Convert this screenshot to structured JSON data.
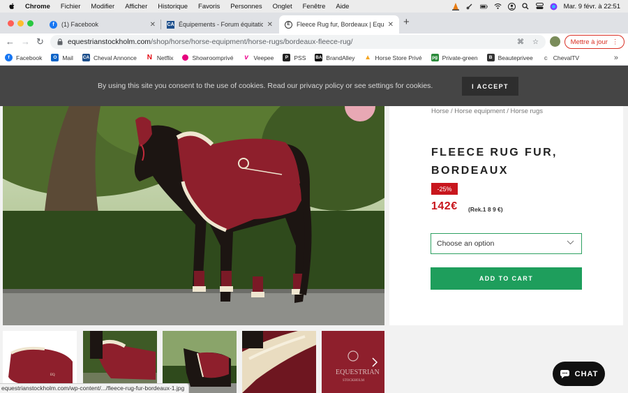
{
  "menubar": {
    "app": "Chrome",
    "items": [
      "Fichier",
      "Modifier",
      "Afficher",
      "Historique",
      "Favoris",
      "Personnes",
      "Onglet",
      "Fenêtre",
      "Aide"
    ],
    "clock": "Mar. 9 févr. à  22:51"
  },
  "tabs": [
    {
      "title": "(1) Facebook",
      "icon": "facebook-icon"
    },
    {
      "title": "Équipements - Forum équitatio",
      "icon": "cheval-annonce-icon"
    },
    {
      "title": "Fleece Rug fur, Bordeaux | Equ",
      "icon": "equestrian-icon",
      "active": true
    }
  ],
  "toolbar": {
    "url_domain": "equestrianstockholm.com",
    "url_path": "/shop/horse/horse-equipment/horse-rugs/bordeaux-fleece-rug/",
    "update_label": "Mettre à jour"
  },
  "bookmarks": [
    {
      "label": "Facebook",
      "icon": "facebook-icon",
      "color": "#1877f2",
      "glyph": "f"
    },
    {
      "label": "Mail",
      "icon": "outlook-icon",
      "color": "#0a64c8",
      "glyph": "O"
    },
    {
      "label": "Cheval Annonce",
      "icon": "cheval-annonce-icon",
      "color": "#1d4f8c",
      "glyph": "CA"
    },
    {
      "label": "Netflix",
      "icon": "netflix-icon",
      "color": "#e50914",
      "glyph": "N"
    },
    {
      "label": "Showroomprivé",
      "icon": "showroomprive-icon",
      "color": "#e6007e",
      "glyph": "●"
    },
    {
      "label": "Veepee",
      "icon": "veepee-icon",
      "color": "#ec008c",
      "glyph": "v"
    },
    {
      "label": "PSS",
      "icon": "pss-icon",
      "color": "#222222",
      "glyph": "P"
    },
    {
      "label": "BrandAlley",
      "icon": "brandalley-icon",
      "color": "#111111",
      "glyph": "BA"
    },
    {
      "label": "Horse Store Privé",
      "icon": "horse-store-icon",
      "color": "#f5a623",
      "glyph": "▲"
    },
    {
      "label": "Private-green",
      "icon": "private-green-icon",
      "color": "#2a8a3a",
      "glyph": "pg"
    },
    {
      "label": "Beauteprivee",
      "icon": "beauteprivee-icon",
      "color": "#333333",
      "glyph": "B"
    },
    {
      "label": "ChevalTV",
      "icon": "chevaltv-icon",
      "color": "#888888",
      "glyph": "c"
    }
  ],
  "cookie": {
    "text": "By using this site you consent to the use of cookies. Read our privacy policy or see settings for cookies.",
    "accept_label": "I ACCEPT"
  },
  "product": {
    "breadcrumb": "Horse / Horse equipment / Horse rugs",
    "title": "FLEECE RUG FUR, BORDEAUX",
    "discount": "-25%",
    "price": "142€",
    "regular_price": "(Rek.1 8 9 €)",
    "select_placeholder": "Choose an option",
    "add_to_cart": "ADD TO CART"
  },
  "status_url": "equestrianstockholm.com/wp-content/.../fleece-rug-fur-bordeaux-1.jpg",
  "chat_label": "CHAT",
  "colors": {
    "accent_green": "#1e9e5c",
    "sale_red": "#c8161d",
    "rug_bordeaux": "#8e1f2c"
  }
}
